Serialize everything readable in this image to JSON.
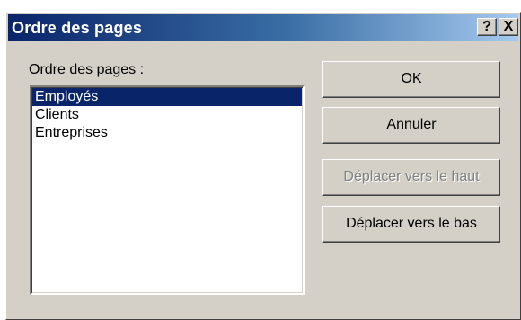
{
  "dialog": {
    "title": "Ordre des pages",
    "help_label": "?",
    "close_label": "X"
  },
  "list": {
    "label": "Ordre des pages :",
    "items": [
      {
        "label": "Employés",
        "selected": true
      },
      {
        "label": "Clients",
        "selected": false
      },
      {
        "label": "Entreprises",
        "selected": false
      }
    ]
  },
  "buttons": {
    "ok": "OK",
    "cancel": "Annuler",
    "move_up": "Déplacer vers le haut",
    "move_down": "Déplacer vers le bas"
  },
  "colors": {
    "title_bar_start": "#0a246a",
    "title_bar_end": "#a6caf0",
    "dialog_face": "#d4d0c8",
    "selection": "#0a246a",
    "disabled_text": "#808080"
  }
}
